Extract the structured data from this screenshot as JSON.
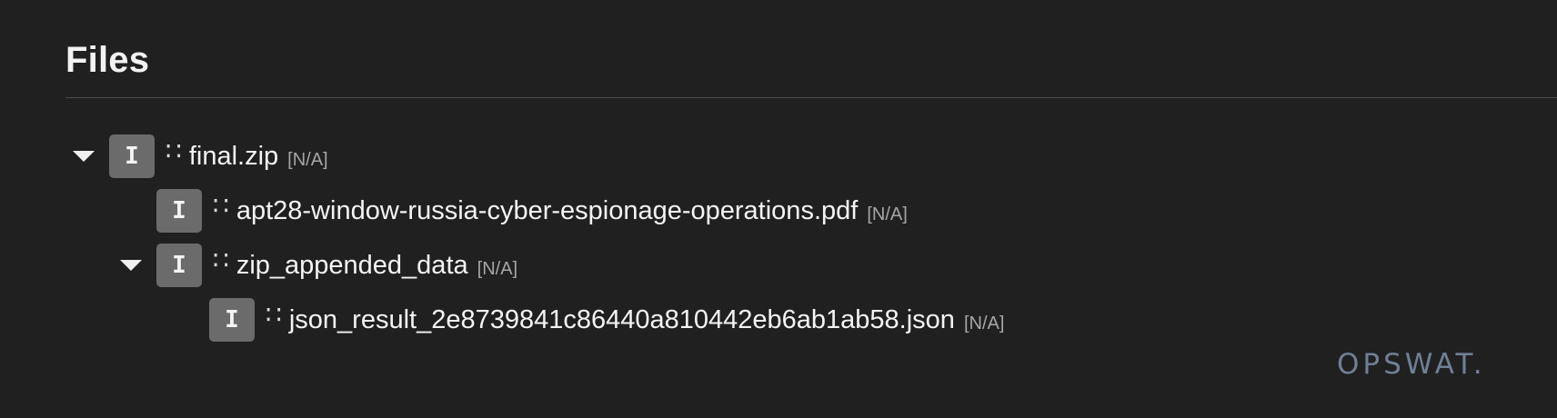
{
  "panel": {
    "title": "Files"
  },
  "tree": {
    "sep_glyph": "∷",
    "badge_glyph": "I",
    "items": [
      {
        "name": "final.zip",
        "status": "[N/A]",
        "expanded": true,
        "level": 0
      },
      {
        "name": "apt28-window-russia-cyber-espionage-operations.pdf",
        "status": "[N/A]",
        "expanded": null,
        "level": 1
      },
      {
        "name": "zip_appended_data",
        "status": "[N/A]",
        "expanded": true,
        "level": 1
      },
      {
        "name": "json_result_2e8739841c86440a810442eb6ab1ab58.json",
        "status": "[N/A]",
        "expanded": null,
        "level": 2
      }
    ]
  },
  "branding": {
    "logo_text": "OPSWAT."
  },
  "colors": {
    "background": "#202020",
    "badge": "#6b6b6b",
    "status_text": "#a6a6a6",
    "logo": "#6f7f96"
  }
}
